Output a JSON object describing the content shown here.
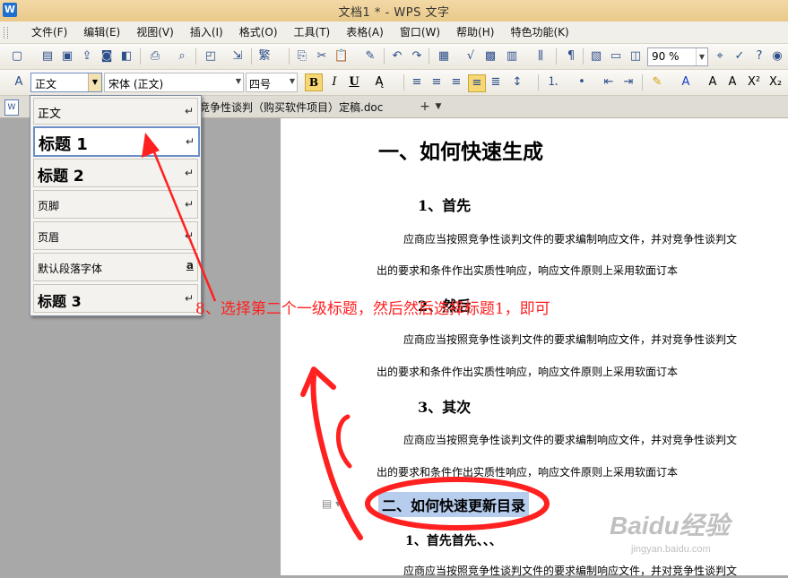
{
  "window": {
    "title": "文档1 * - WPS 文字",
    "app_icon": "W"
  },
  "menubar": {
    "items": [
      "文件(F)",
      "编辑(E)",
      "视图(V)",
      "插入(I)",
      "格式(O)",
      "工具(T)",
      "表格(A)",
      "窗口(W)",
      "帮助(H)",
      "特色功能(K)"
    ]
  },
  "toolbar": {
    "zoom_value": "90 %"
  },
  "format_bar": {
    "style_value": "正文",
    "font_value": "宋体 (正文)",
    "size_value": "四号",
    "bold": "B",
    "italic": "I",
    "underline": "U"
  },
  "tabs": {
    "doc_tab_label": "竞争性谈判（购买软件项目）定稿.doc",
    "add_label": "+"
  },
  "style_dropdown": {
    "items": [
      {
        "label": "正文",
        "mark": "↵"
      },
      {
        "label": "标题  1",
        "mark": "↵"
      },
      {
        "label": "标题  2",
        "mark": "↵"
      },
      {
        "label": "页脚",
        "mark": "↵"
      },
      {
        "label": "页眉",
        "mark": "↵"
      },
      {
        "label": "默认段落字体",
        "mark": "a"
      },
      {
        "label": "标题  3",
        "mark": "↵"
      }
    ]
  },
  "document": {
    "h1_a": "一、如何快速生成",
    "h2_1": "1、首先",
    "body_1a": "应商应当按照竞争性谈判文件的要求编制响应文件，并对竞争性谈判文",
    "body_1b": "出的要求和条件作出实质性响应，响应文件原则上采用软面订本",
    "h2_2": "2、然后",
    "body_2a": "应商应当按照竞争性谈判文件的要求编制响应文件，并对竞争性谈判文",
    "body_2b": "出的要求和条件作出实质性响应，响应文件原则上采用软面订本",
    "h2_3": "3、其次",
    "body_3a": "应商应当按照竞争性谈判文件的要求编制响应文件，并对竞争性谈判文",
    "body_3b": "出的要求和条件作出实质性响应，响应文件原则上采用软面订本",
    "h1_b": "二、如何快速更新目录",
    "h2_4": "1、首先首先、、、",
    "body_4a": "应商应当按照竞争性谈判文件的要求编制响应文件，并对竞争性谈判文"
  },
  "annotation": {
    "text": "8、选择第二个一级标题，然后然后选择标题1，即可",
    "color": "#ff1f1f"
  },
  "watermark": {
    "logo": "Baidu经验",
    "url": "jingyan.baidu.com"
  }
}
